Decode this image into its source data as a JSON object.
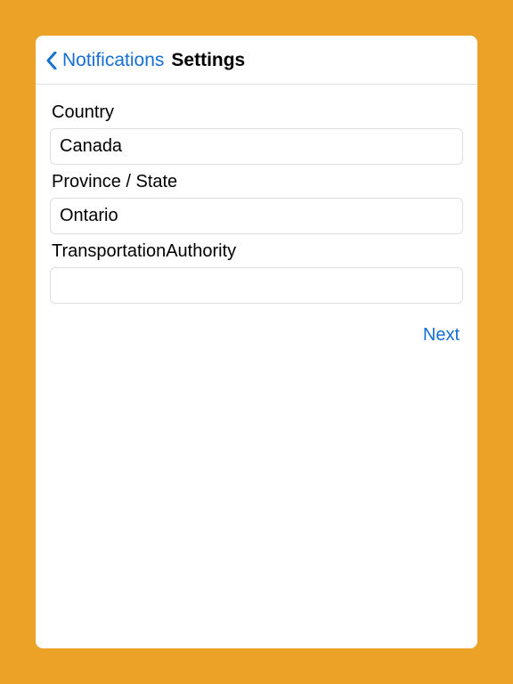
{
  "header": {
    "back_label": "Notifications",
    "title": "Settings"
  },
  "form": {
    "country": {
      "label": "Country",
      "value": "Canada"
    },
    "province": {
      "label": "Province / State",
      "value": "Ontario"
    },
    "authority": {
      "label": "TransportationAuthority",
      "value": ""
    },
    "next_label": "Next"
  },
  "colors": {
    "accent": "#eba226",
    "link": "#166fd6"
  }
}
